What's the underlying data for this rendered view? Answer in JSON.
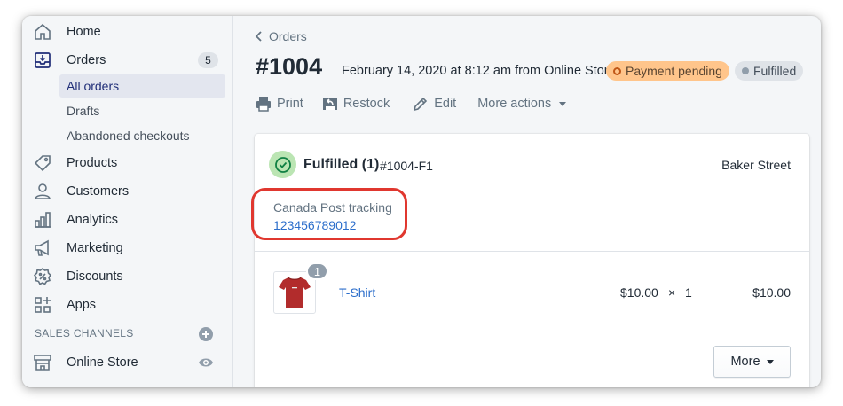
{
  "sidebar": {
    "items": [
      {
        "label": "Home",
        "icon": "home-icon"
      },
      {
        "label": "Orders",
        "icon": "orders-icon",
        "badge": "5"
      },
      {
        "label": "Products",
        "icon": "tag-icon"
      },
      {
        "label": "Customers",
        "icon": "person-icon"
      },
      {
        "label": "Analytics",
        "icon": "bar-chart-icon"
      },
      {
        "label": "Marketing",
        "icon": "megaphone-icon"
      },
      {
        "label": "Discounts",
        "icon": "discount-icon"
      },
      {
        "label": "Apps",
        "icon": "apps-icon"
      }
    ],
    "orders_sub": [
      {
        "label": "All orders"
      },
      {
        "label": "Drafts"
      },
      {
        "label": "Abandoned checkouts"
      }
    ],
    "sales_channels_title": "SALES CHANNELS",
    "online_store_label": "Online Store"
  },
  "breadcrumb": {
    "label": "Orders"
  },
  "order": {
    "number": "#1004",
    "meta": "February 14, 2020 at 8:12 am from Online Store",
    "payment_status": "Payment pending",
    "fulfillment_status": "Fulfilled"
  },
  "actions": {
    "print": "Print",
    "restock": "Restock",
    "edit": "Edit",
    "more": "More actions"
  },
  "fulfillment": {
    "title": "Fulfilled (1)",
    "id": "#1004-F1",
    "location": "Baker Street",
    "tracking_label": "Canada Post tracking",
    "tracking_number": "123456789012"
  },
  "line_item": {
    "qty_badge": "1",
    "name": "T-Shirt",
    "unit_price": "$10.00",
    "times": "×",
    "quantity": "1",
    "total": "$10.00"
  },
  "more_button": "More",
  "colors": {
    "accent_link": "#2c6ecb",
    "pending_pill": "#ffc58b",
    "fulfilled_pill": "#dfe3e8",
    "highlight_ring": "#e0372f",
    "fulfilled_circle": "#bbe5b3"
  }
}
